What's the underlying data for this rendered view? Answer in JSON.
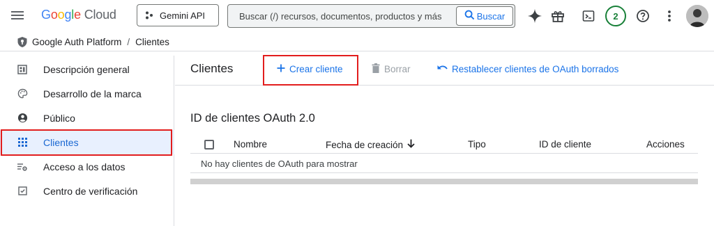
{
  "header": {
    "menu_icon": "hamburger-menu-icon",
    "logo": {
      "google": [
        "G",
        "o",
        "o",
        "g",
        "l",
        "e"
      ],
      "cloud": "Cloud"
    },
    "project_button": {
      "label": "Gemini API",
      "icon": "project-selector-icon"
    },
    "search": {
      "placeholder": "Buscar (/) recursos, documentos, productos y más",
      "button_label": "Buscar"
    },
    "icons": [
      "gemini-spark-icon",
      "gift-icon",
      "cloud-shell-icon",
      "help-icon",
      "more-vert-icon"
    ],
    "notification_count": "2",
    "colors": {
      "brand_blue": "#1a73e8",
      "notif_green": "#188038",
      "highlight_red": "#e21d1d"
    }
  },
  "breadcrumb": {
    "items": [
      "Google Auth Platform",
      "Clientes"
    ],
    "separator": "/"
  },
  "sidebar": {
    "items": [
      {
        "label": "Descripción general",
        "icon": "dashboard-icon"
      },
      {
        "label": "Desarrollo de la marca",
        "icon": "palette-icon"
      },
      {
        "label": "Público",
        "icon": "person-icon"
      },
      {
        "label": "Clientes",
        "icon": "apps-grid-icon",
        "active": true
      },
      {
        "label": "Acceso a los datos",
        "icon": "data-settings-icon"
      },
      {
        "label": "Centro de verificación",
        "icon": "verification-icon"
      }
    ]
  },
  "main": {
    "title": "Clientes",
    "actions": {
      "create": "Crear cliente",
      "delete": "Borrar",
      "restore": "Restablecer clientes de OAuth borrados"
    },
    "section_title": "ID de clientes OAuth 2.0",
    "table": {
      "columns": [
        "Nombre",
        "Fecha de creación",
        "Tipo",
        "ID de cliente",
        "Acciones"
      ],
      "empty_message": "No hay clientes de OAuth para mostrar"
    }
  }
}
